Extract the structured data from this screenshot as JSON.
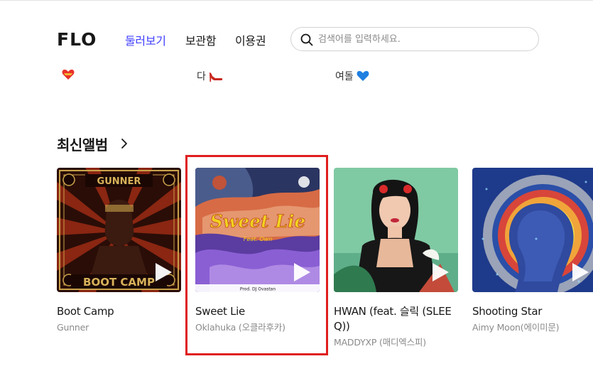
{
  "header": {
    "logo_text": "FLO",
    "nav": {
      "browse": "둘러보기",
      "storage": "보관함",
      "voucher": "이용권"
    },
    "search": {
      "placeholder": "검색어를 입력하세요.",
      "value": ""
    }
  },
  "tags": [
    {
      "text": "",
      "emoji_icon": "heart-icon"
    },
    {
      "text": "다",
      "emoji_icon": "high-heel-icon"
    },
    {
      "text": "여돌",
      "emoji_icon": "blue-heart-icon"
    }
  ],
  "section": {
    "title": "최신앨범"
  },
  "albums": [
    {
      "title": "Boot Camp",
      "artist": "Gunner",
      "cover_text_top": "GUNNER",
      "cover_text_bottom": "BOOT CAMP"
    },
    {
      "title": "Sweet Lie",
      "artist": "Oklahuka (오클라후카)",
      "cover_text_title": "Sweet Lie",
      "cover_text_feat": "Feat. Own",
      "cover_text_credit": "Prod. DJ Ovastan"
    },
    {
      "title": "HWAN (feat. 슬릭 (SLEE Q))",
      "artist": "MADDYXP (매디엑스피)"
    },
    {
      "title": "Shooting Star",
      "artist": "Aimy Moon(에이미문)"
    }
  ],
  "colors": {
    "accent": "#3f3fff",
    "highlight_border": "#e01e1e",
    "muted_text": "#8a8a8a"
  }
}
